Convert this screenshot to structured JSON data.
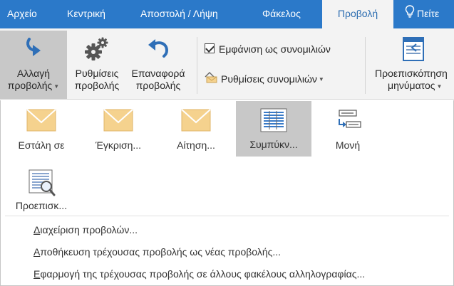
{
  "tabs": [
    {
      "label": "Αρχείο"
    },
    {
      "label": "Κεντρική"
    },
    {
      "label": "Αποστολή / Λήψη"
    },
    {
      "label": "Φάκελος"
    },
    {
      "label": "Προβολή"
    },
    {
      "label": "Πείτε"
    }
  ],
  "active_tab": "Προβολή",
  "ribbon": {
    "change_view": {
      "line1": "Αλλαγή",
      "line2": "προβολής"
    },
    "view_settings": {
      "line1": "Ρυθμίσεις",
      "line2": "προβολής"
    },
    "reset_view": {
      "line1": "Επαναφορά",
      "line2": "προβολής"
    },
    "show_as_conversations": {
      "label": "Εμφάνιση ως συνομιλιών",
      "checked": true
    },
    "conversation_settings": {
      "label": "Ρυθμίσεις συνομιλιών"
    },
    "message_preview": {
      "line1": "Προεπισκόπηση",
      "line2": "μηνύματος"
    }
  },
  "views": [
    {
      "label": "Εστάλη σε",
      "icon": "envelope-icon",
      "selected": false
    },
    {
      "label": "Έγκριση...",
      "icon": "envelope-icon",
      "selected": false
    },
    {
      "label": "Αίτηση...",
      "icon": "envelope-icon",
      "selected": false
    },
    {
      "label": "Συμπύκν...",
      "icon": "compact-list-icon",
      "selected": true
    },
    {
      "label": "Μονή",
      "icon": "single-view-icon",
      "selected": false
    },
    {
      "label": "Προεπισκ...",
      "icon": "preview-magnifier-icon",
      "selected": false
    }
  ],
  "menu": {
    "manage_views": {
      "ul": "Δ",
      "rest": "ιαχείριση προβολών..."
    },
    "save_view": {
      "ul": "Α",
      "rest": "ποθήκευση τρέχουσας προβολής ως νέας προβολής..."
    },
    "apply_view": {
      "ul": "Ε",
      "rest": "φαρμογή της τρέχουσας προβολής σε άλλους φακέλους αλληλογραφίας..."
    }
  },
  "colors": {
    "tab_bar": "#2b79c9",
    "ribbon_bg": "#f3f3f3",
    "selected_bg": "#c8c8c8",
    "envelope": "#f5d28e",
    "icon_blue": "#2f6fb7"
  }
}
